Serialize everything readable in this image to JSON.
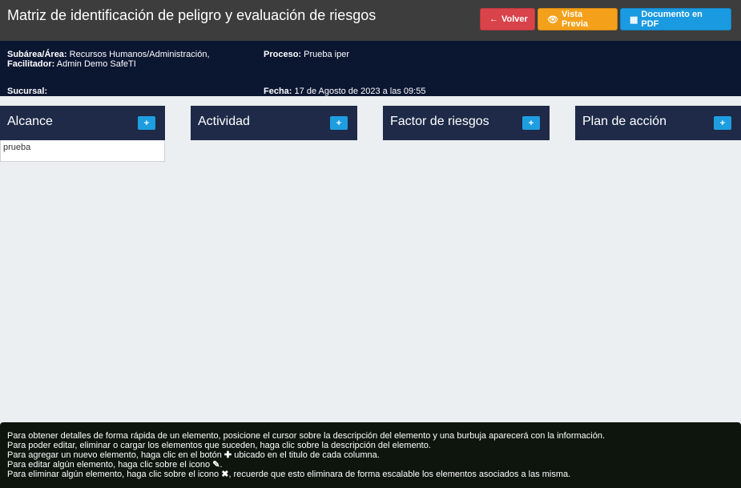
{
  "header": {
    "title": "Matriz de identificación de peligro y evaluación de riesgos",
    "buttons": {
      "back": {
        "icon": "←",
        "label": "Volver"
      },
      "preview": {
        "icon": "👁",
        "label": "Vista Previa"
      },
      "pdf": {
        "icon": "▦",
        "label": "Documento en PDF"
      }
    }
  },
  "info": {
    "subarea_label": "Subárea/Área:",
    "subarea_value": "Recursos Humanos/Administración,",
    "facilitador_label": "Facilitador:",
    "facilitador_value": "Admin Demo SafeTI",
    "sucursal_label": "Sucursal:",
    "sucursal_value": "",
    "proceso_label": "Proceso:",
    "proceso_value": "Prueba iper",
    "fecha_label": "Fecha:",
    "fecha_value": "17 de Agosto de 2023 a las 09:55"
  },
  "columns": [
    {
      "label": "Alcance",
      "add": "+"
    },
    {
      "label": "Actividad",
      "add": "+"
    },
    {
      "label": "Factor de riesgos",
      "add": "+"
    },
    {
      "label": "Plan de acción",
      "add": "+"
    }
  ],
  "alcance_items": [
    "prueba"
  ],
  "help": [
    "Para obtener detalles de forma rápida de un elemento, posicione el cursor sobre la descripción del elemento y una burbuja aparecerá con la información.",
    "Para poder editar, eliminar o cargar los elementos que suceden, haga clic sobre la descripción del elemento.",
    {
      "before": "Para agregar un nuevo elemento, haga clic en el botón ",
      "icon": "✚",
      "after": " ubicado en el titulo de cada columna."
    },
    {
      "before": "Para editar algún elemento, haga clic sobre el icono ",
      "icon": "✎",
      "after": "."
    },
    {
      "before": "Para eliminar algún elemento, haga clic sobre el icono ",
      "icon": "✖",
      "after": ", recuerde que esto eliminara de forma escalable los elementos asociados a las misma."
    }
  ]
}
